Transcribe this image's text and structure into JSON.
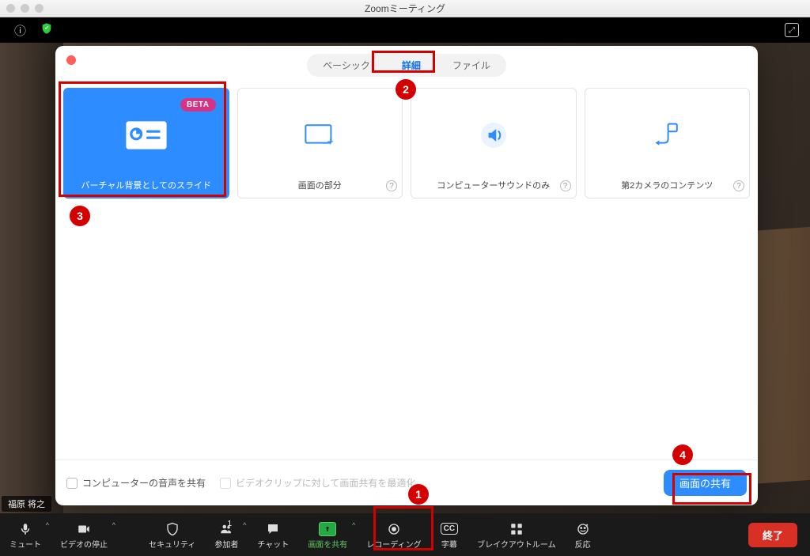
{
  "window": {
    "title": "Zoomミーティング"
  },
  "nameTag": "福原 将之",
  "dialog": {
    "tabs": {
      "basic": "ベーシック",
      "advanced": "詳細",
      "files": "ファイル"
    },
    "options": {
      "slides": {
        "label": "バーチャル背景としてのスライド",
        "beta": "BETA"
      },
      "portion": {
        "label": "画面の部分"
      },
      "audioOnly": {
        "label": "コンピューターサウンドのみ"
      },
      "secondCam": {
        "label": "第2カメラのコンテンツ"
      }
    },
    "footer": {
      "shareAudio": "コンピューターの音声を共有",
      "optimize": "ビデオクリップに対して画面共有を最適化",
      "shareBtn": "画面の共有"
    }
  },
  "controls": {
    "mute": "ミュート",
    "stopVideo": "ビデオの停止",
    "security": "セキュリティ",
    "participants": "参加者",
    "participantsCount": "1",
    "chat": "チャット",
    "shareScreen": "画面を共有",
    "recording": "レコーディング",
    "cc": "字幕",
    "breakout": "ブレイクアウトルーム",
    "reactions": "反応",
    "end": "終了"
  },
  "annotations": {
    "n1": "1",
    "n2": "2",
    "n3": "3",
    "n4": "4"
  }
}
